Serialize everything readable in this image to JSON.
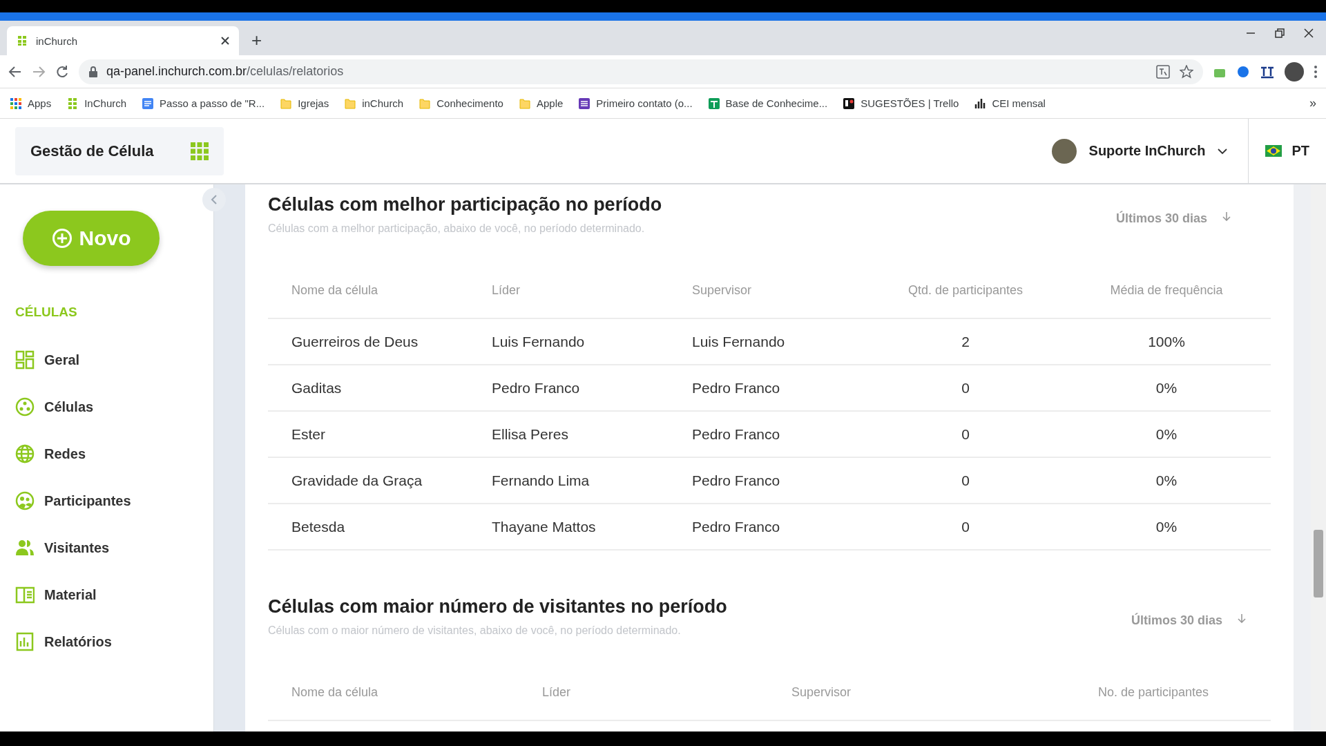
{
  "browser": {
    "tabs": [
      {
        "title": "inChurch",
        "selected": true
      }
    ],
    "new_tab": "+",
    "url_host": "qa-panel.inchurch.com.br",
    "url_path": "/celulas/relatorios",
    "bookmarks": [
      {
        "label": "Apps",
        "kind": "apps"
      },
      {
        "label": "InChurch",
        "kind": "favicon"
      },
      {
        "label": "Passo a passo de \"R...",
        "kind": "doc"
      },
      {
        "label": "Igrejas",
        "kind": "folder"
      },
      {
        "label": "inChurch",
        "kind": "folder"
      },
      {
        "label": "Conhecimento",
        "kind": "folder"
      },
      {
        "label": "Apple",
        "kind": "folder"
      },
      {
        "label": "Primeiro contato (o...",
        "kind": "form"
      },
      {
        "label": "Base de Conhecime...",
        "kind": "sheet"
      },
      {
        "label": "SUGESTÕES | Trello",
        "kind": "trello"
      },
      {
        "label": "CEI mensal",
        "kind": "chart"
      }
    ],
    "more_bookmarks": "»"
  },
  "app_header": {
    "title": "Gestão de Célula",
    "user": "Suporte InChurch",
    "language": "PT"
  },
  "sidebar": {
    "new_button": "Novo",
    "section": "CÉLULAS",
    "items": [
      {
        "label": "Geral",
        "kind": "dashboard"
      },
      {
        "label": "Células",
        "kind": "cells"
      },
      {
        "label": "Redes",
        "kind": "globe"
      },
      {
        "label": "Participantes",
        "kind": "participants"
      },
      {
        "label": "Visitantes",
        "kind": "people"
      },
      {
        "label": "Material",
        "kind": "book"
      },
      {
        "label": "Relatórios",
        "kind": "chart"
      }
    ]
  },
  "sections": [
    {
      "title": "Células com melhor participação no período",
      "subtitle": "Células com a melhor participação, abaixo de você, no período determinado.",
      "period": "Últimos 30 dias",
      "columns": [
        {
          "label": "Nome da célula",
          "kind": "text"
        },
        {
          "label": "Líder",
          "kind": "text"
        },
        {
          "label": "Supervisor",
          "kind": "text"
        },
        {
          "label": "Qtd. de participantes",
          "kind": "number"
        },
        {
          "label": "Média de frequência",
          "kind": "number"
        }
      ],
      "rows": [
        [
          "Guerreiros de Deus",
          "Luis Fernando",
          "Luis Fernando",
          "2",
          "100%"
        ],
        [
          "Gaditas",
          "Pedro Franco",
          "Pedro Franco",
          "0",
          "0%"
        ],
        [
          "Ester",
          "Ellisa Peres",
          "Pedro Franco",
          "0",
          "0%"
        ],
        [
          "Gravidade da Graça",
          "Fernando Lima",
          "Pedro Franco",
          "0",
          "0%"
        ],
        [
          "Betesda",
          "Thayane Mattos",
          "Pedro Franco",
          "0",
          "0%"
        ]
      ]
    },
    {
      "title": "Células com maior número de visitantes no período",
      "subtitle": "Células com o maior número de visitantes, abaixo de você, no período determinado.",
      "period": "Últimos 30 dias",
      "columns": [
        {
          "label": "Nome da célula",
          "kind": "text"
        },
        {
          "label": "Líder",
          "kind": "text"
        },
        {
          "label": "Supervisor",
          "kind": "text"
        },
        {
          "label": "No. de participantes",
          "kind": "number"
        }
      ]
    }
  ]
}
